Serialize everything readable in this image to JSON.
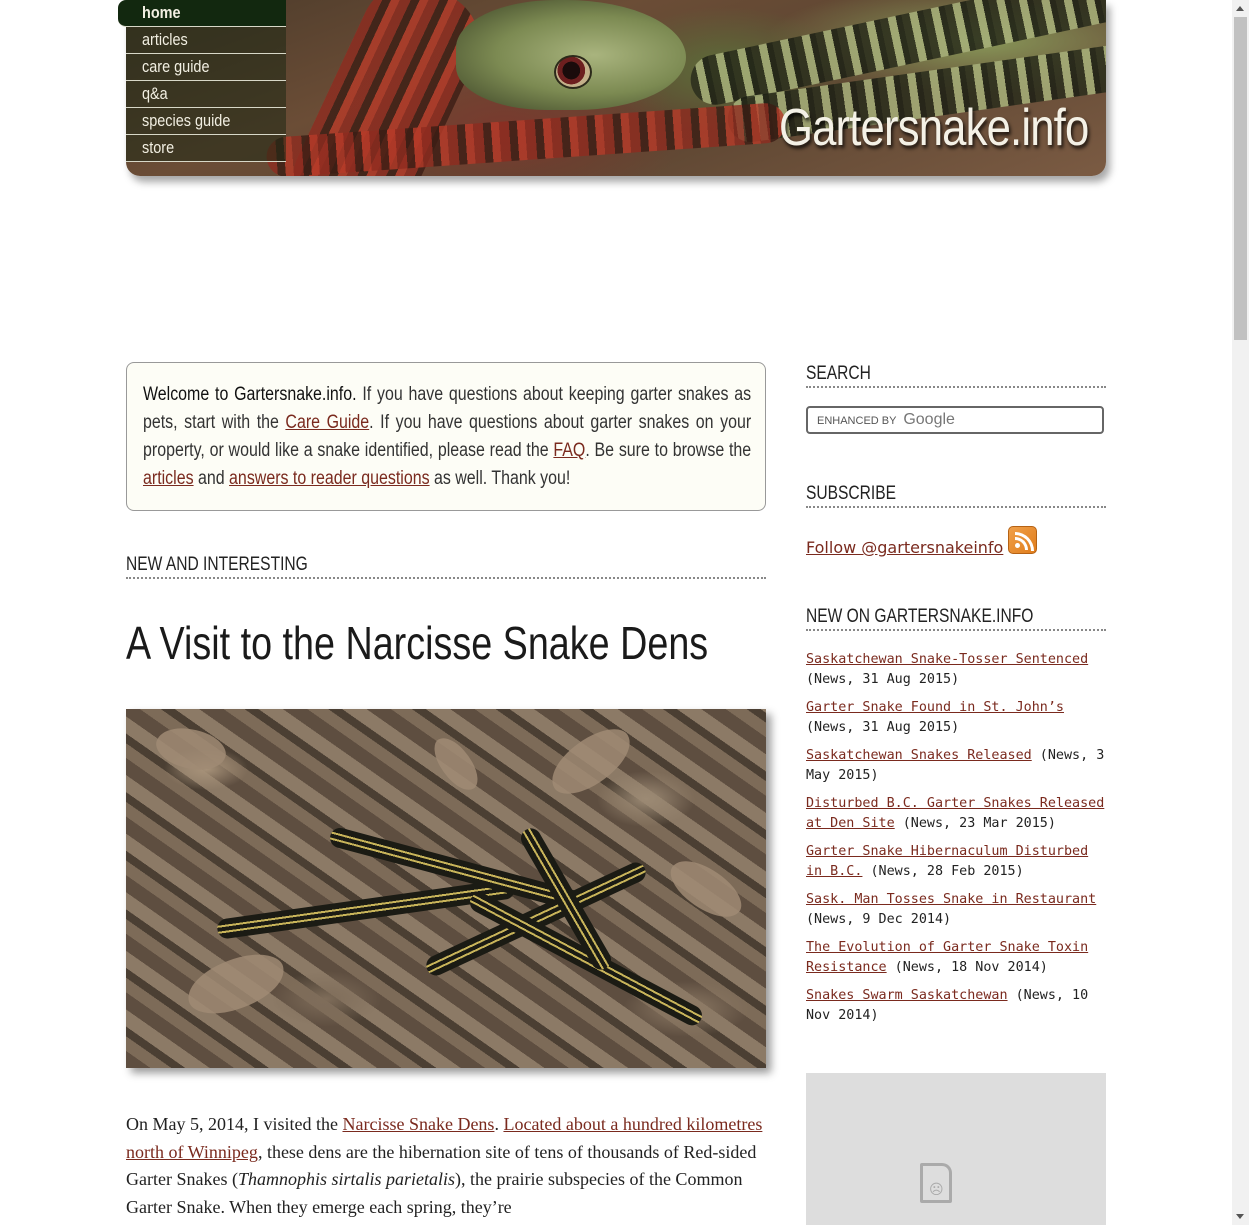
{
  "header": {
    "site_title": "Gartersnake.info"
  },
  "nav": {
    "items": [
      {
        "label": "home",
        "active": true
      },
      {
        "label": "articles"
      },
      {
        "label": "care guide"
      },
      {
        "label": "q&a"
      },
      {
        "label": "species guide"
      },
      {
        "label": "store"
      }
    ]
  },
  "welcome": {
    "lead": "Welcome to Gartersnake.info.",
    "t1": " If you have questions about keeping garter snakes as pets, start with the ",
    "care_guide_link": "Care Guide",
    "t2": ". If you have questions about garter snakes on your property, or would like a snake identified, please read the ",
    "faq_link": "FAQ",
    "t3": ". Be sure to browse the ",
    "articles_link": "articles",
    "t4": " and ",
    "answers_link": "answers to reader questions",
    "t5": " as well. Thank you!"
  },
  "main": {
    "section_heading": "NEW AND INTERESTING",
    "article_title": "A Visit to the Narcisse Snake Dens",
    "body": {
      "t1": "On May 5, 2014, I visited the ",
      "link1": "Narcisse Snake Dens",
      "t2": ". ",
      "link2": "Located about a hundred kilometres north of Winnipeg",
      "t3": ", these dens are the hibernation site of tens of thousands of Red-sided Garter Snakes (",
      "species": "Thamnophis sirtalis parietalis",
      "t4": "), the prairie subspecies of the Common Garter Snake. When they emerge each spring, they’re"
    }
  },
  "sidebar": {
    "search_heading": "SEARCH",
    "search_placeholder_prefix": "ENHANCED BY",
    "search_placeholder_brand": "Google",
    "subscribe_heading": "SUBSCRIBE",
    "follow_link": "Follow @gartersnakeinfo",
    "rss_icon": "rss-icon",
    "new_heading": "NEW ON GARTERSNAKE.INFO",
    "news": [
      {
        "title": "Saskatchewan Snake-Tosser Sentenced",
        "meta": " (News, 31 Aug 2015)"
      },
      {
        "title": "Garter Snake Found in St. John’s ",
        "meta": "(News, 31 Aug 2015)"
      },
      {
        "title": "Saskatchewan Snakes Released",
        "meta": " (News, 3 May 2015)"
      },
      {
        "title": "Disturbed B.C. Garter Snakes Released at Den Site",
        "meta": " (News, 23 Mar 2015)"
      },
      {
        "title": "Garter Snake Hibernaculum Disturbed in B.C.",
        "meta": " (News, 28 Feb 2015)"
      },
      {
        "title": "Sask. Man Tosses Snake in Restaurant",
        "meta": " (News, 9 Dec 2014)"
      },
      {
        "title": "The Evolution of Garter Snake Toxin Resistance",
        "meta": " (News, 18 Nov 2014)"
      },
      {
        "title": "Snakes Swarm Saskatchewan",
        "meta": " (News, 10 Nov 2014)"
      }
    ]
  },
  "colors": {
    "link": "#7a2a1e",
    "nav_active": "#12280f",
    "welcome_bg": "#fdfdf6"
  }
}
